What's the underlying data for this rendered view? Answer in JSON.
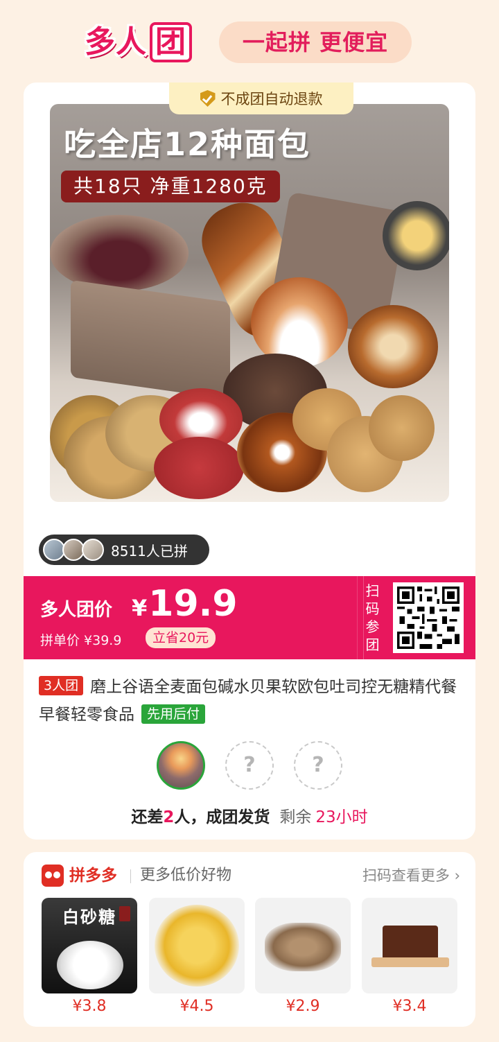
{
  "header": {
    "logo_text": "多人",
    "logo_box_text": "团",
    "slogan": "一起拼 更便宜"
  },
  "product": {
    "refund_badge": "不成团自动退款",
    "image_headline": "吃全店12种面包",
    "image_subline": "共18只 净重1280克",
    "joined_count": "8511人已拼",
    "group_price_label": "多人团价",
    "currency": "¥",
    "group_price": "19.9",
    "single_price": "拼单价 ¥39.9",
    "save_badge": "立省20元",
    "scan_label": [
      "扫",
      "码",
      "参",
      "团"
    ],
    "group_size_tag": "3人团",
    "title": "磨上谷语全麦面包碱水贝果软欧包吐司控无糖精代餐早餐轻零食品",
    "pay_later_tag": "先用后付",
    "empty_slot_mark": "?",
    "status_prefix": "还差",
    "status_count": "2",
    "status_suffix": "人，成团发货",
    "remaining_label": "剩余",
    "remaining_time": "23小时"
  },
  "recommend": {
    "brand": "拼多多",
    "subtitle": "更多低价好物",
    "more_link": "扫码查看更多",
    "items": [
      {
        "label": "白砂糖",
        "price": "¥3.8"
      },
      {
        "price": "¥4.5"
      },
      {
        "price": "¥2.9"
      },
      {
        "price": "¥3.4"
      }
    ]
  },
  "colors": {
    "accent": "#e8175d",
    "page_bg": "#fdf1e4",
    "pay_later_green": "#2aa53a",
    "brand_red": "#e02e24"
  }
}
